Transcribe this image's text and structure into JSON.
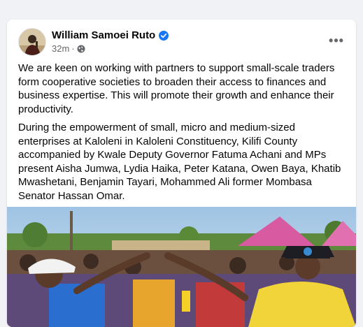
{
  "post": {
    "author": "William Samoei Ruto",
    "time": "32m",
    "more_label": "•••",
    "paragraph1": "We are keen on working with partners to support small-scale traders form cooperative societies to broaden their access to finances and business expertise. This will promote their growth and enhance their productivity.",
    "paragraph2": "During the empowerment of small, micro and medium-sized enterprises at Kaloleni in Kaloleni Constituency, Kilifi County accompanied by Kwale Deputy Governor Fatuma Achani and MPs present Aisha Jumwa, Lydia Haika, Peter Katana, Owen Baya, Khatib Mwashetani, Benjamin Tayari, Mohammed Ali former Mombasa Senator Hassan Omar."
  },
  "icons": {
    "verified": "verified-badge-icon",
    "privacy": "globe-icon",
    "more": "more-options-icon"
  },
  "colors": {
    "background": "#f0f2f5",
    "card": "#ffffff",
    "text": "#050505",
    "secondary_text": "#65676b",
    "verified_blue": "#1877f2"
  }
}
